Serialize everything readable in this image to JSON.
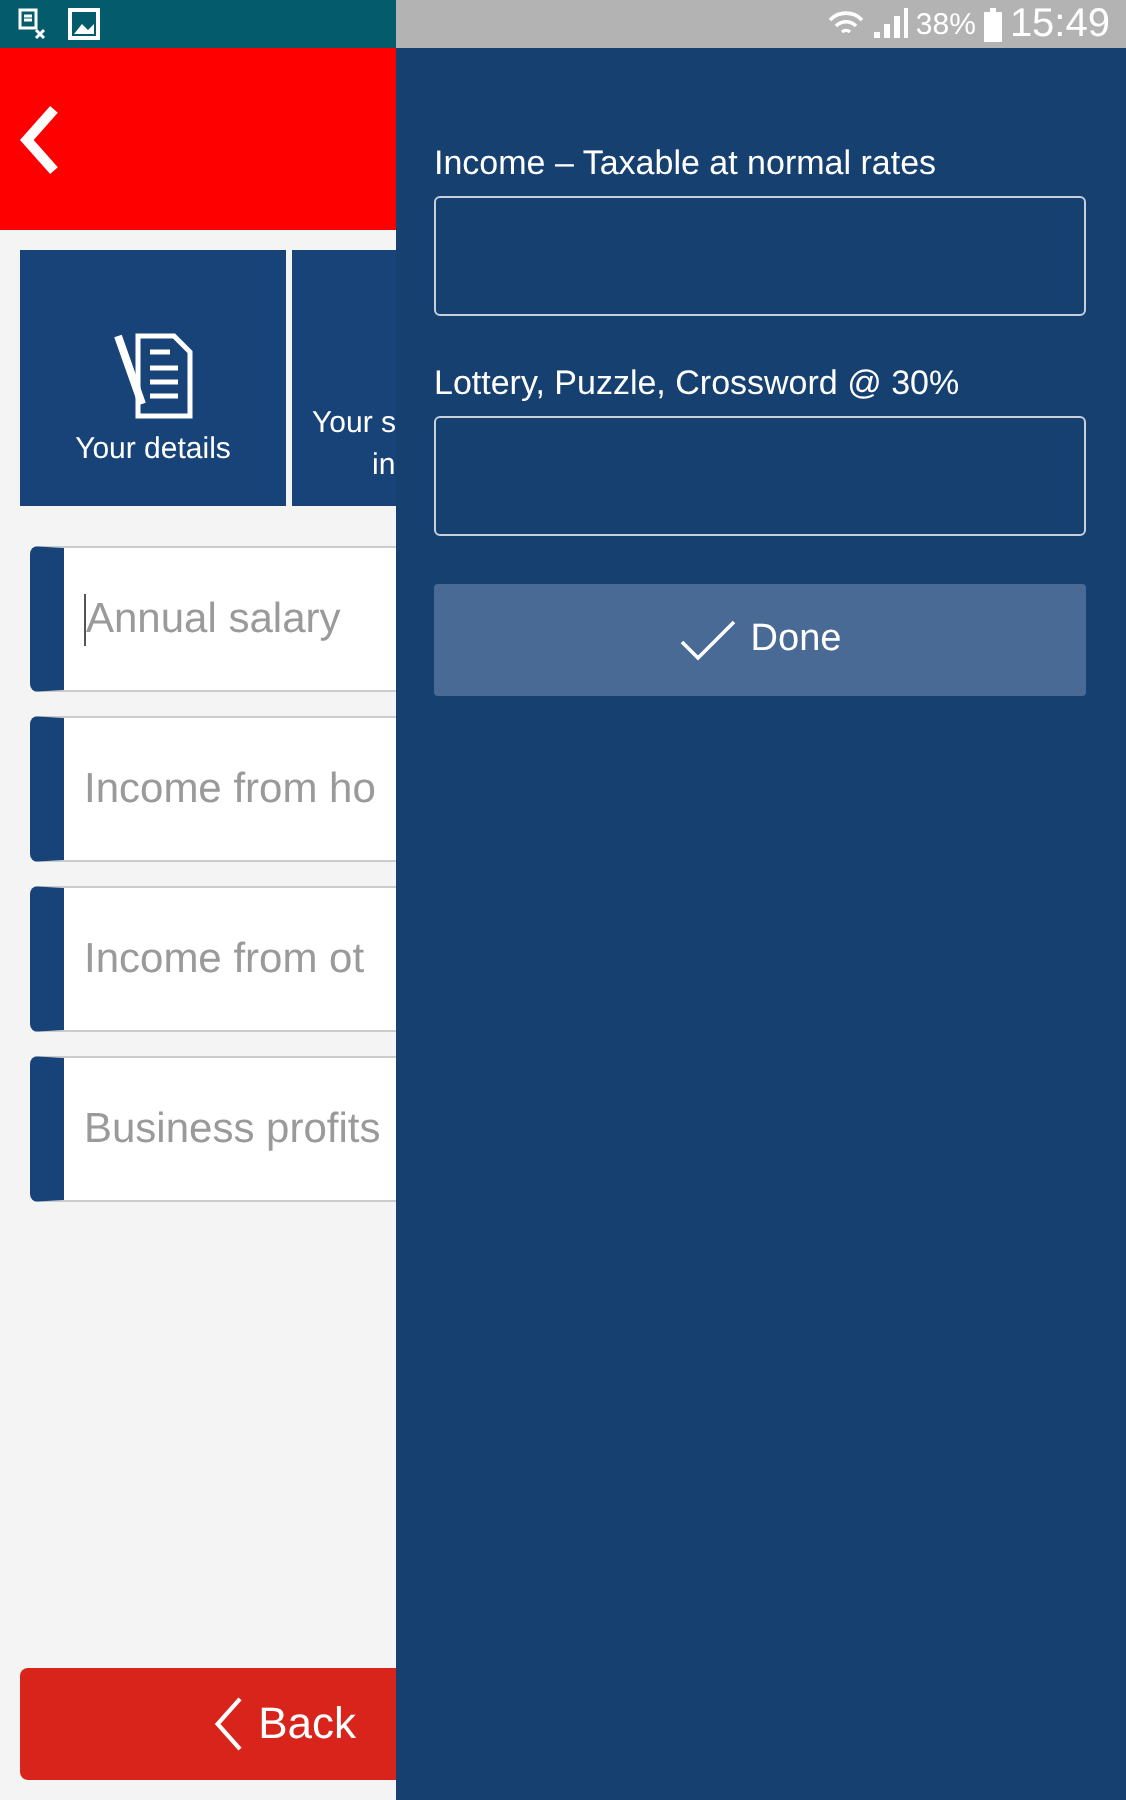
{
  "status_bar": {
    "battery": "38%",
    "time": "15:49"
  },
  "tiles": [
    {
      "lines": [
        "Your details"
      ]
    },
    {
      "lines": [
        "Your s",
        "in"
      ]
    }
  ],
  "fields": [
    {
      "placeholder": "Annual salary",
      "focused": true
    },
    {
      "placeholder": "Income from ho",
      "focused": false
    },
    {
      "placeholder": "Income from ot",
      "focused": false
    },
    {
      "placeholder": "Business profits",
      "focused": false
    }
  ],
  "back_button": {
    "label": "Back"
  },
  "drawer": {
    "fields": [
      {
        "label": "Income – Taxable at normal rates"
      },
      {
        "label": "Lottery, Puzzle, Crossword @ 30%"
      }
    ],
    "done_button": {
      "label": "Done"
    }
  }
}
